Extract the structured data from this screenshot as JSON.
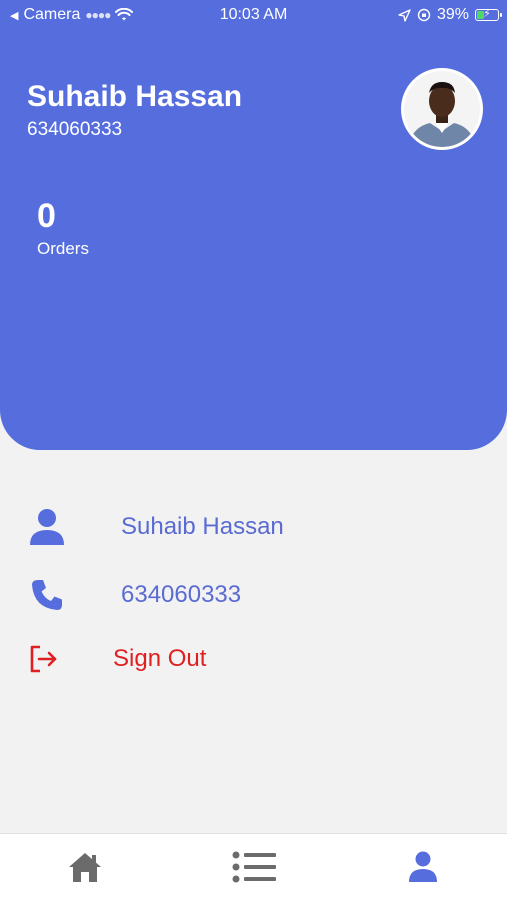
{
  "status_bar": {
    "back_label": "Camera",
    "time": "10:03 AM",
    "battery_percent": "39%",
    "battery_level": 0.39
  },
  "profile": {
    "name": "Suhaib Hassan",
    "phone": "634060333",
    "avatar_icon": "user-photo"
  },
  "stats": {
    "orders_count": "0",
    "orders_label": "Orders"
  },
  "details": {
    "name_value": "Suhaib Hassan",
    "phone_value": "634060333",
    "sign_out_label": "Sign Out"
  },
  "tab_bar": {
    "items": [
      {
        "icon": "home-icon",
        "active": false
      },
      {
        "icon": "list-icon",
        "active": false
      },
      {
        "icon": "user-icon",
        "active": true
      }
    ]
  },
  "colors": {
    "primary": "#566dde",
    "background": "#f2f2f2",
    "danger": "#e02020",
    "inactive_icon": "#6b6b6b"
  }
}
